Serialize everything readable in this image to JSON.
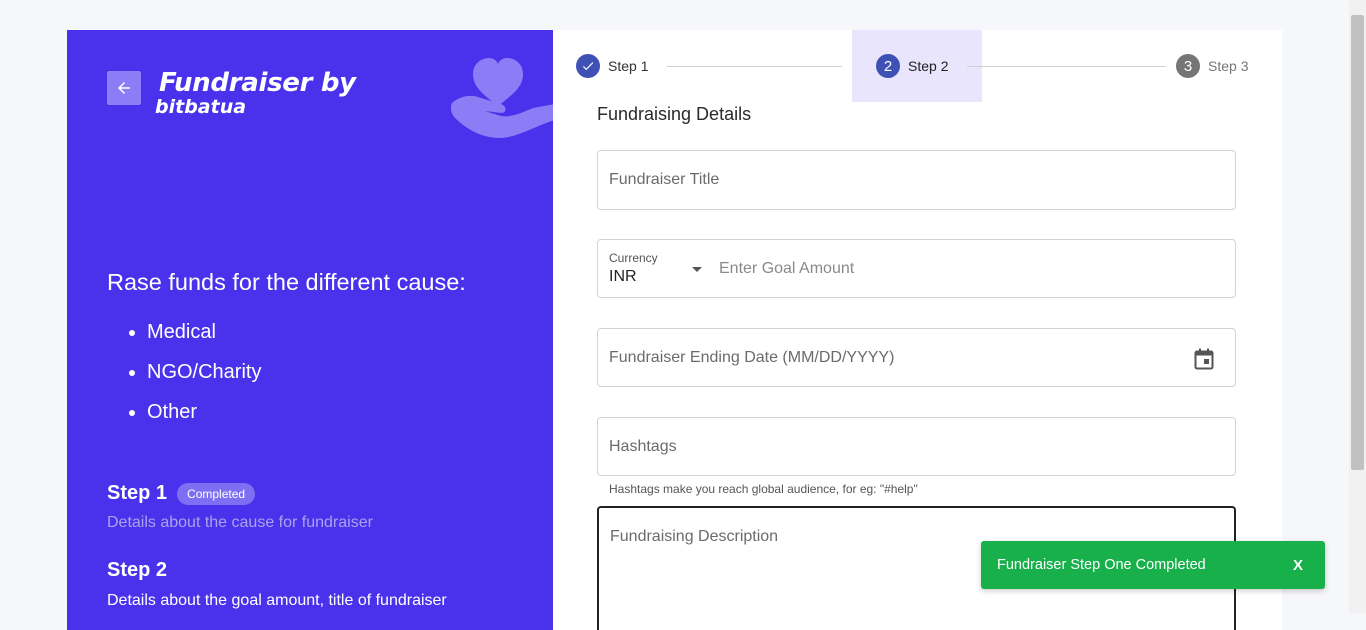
{
  "brand": {
    "line1": "Fundraiser by",
    "line2": "bitbatua"
  },
  "left": {
    "cause_title": "Rase funds for the different cause:",
    "causes": [
      "Medical",
      "NGO/Charity",
      "Other"
    ],
    "step1": {
      "title": "Step 1",
      "badge": "Completed",
      "desc": "Details about the cause for fundraiser"
    },
    "step2": {
      "title": "Step 2",
      "desc": "Details about the goal amount, title of fundraiser"
    }
  },
  "stepper": {
    "steps": [
      {
        "label": "Step 1",
        "state": "completed"
      },
      {
        "label": "Step 2",
        "number": "2",
        "state": "active"
      },
      {
        "label": "Step 3",
        "number": "3",
        "state": "pending"
      }
    ]
  },
  "form": {
    "section_title": "Fundraising Details",
    "title_placeholder": "Fundraiser Title",
    "currency_label": "Currency",
    "currency_value": "INR",
    "goal_placeholder": "Enter Goal Amount",
    "date_placeholder": "Fundraiser Ending Date (MM/DD/YYYY)",
    "hashtags_placeholder": "Hashtags",
    "hashtags_helper": "Hashtags make you reach global audience, for eg: \"#help\"",
    "description_placeholder": "Fundraising Description"
  },
  "toast": {
    "message": "Fundraiser Step One Completed",
    "close": "X"
  },
  "colors": {
    "primary": "#4a31ec",
    "accent": "#8c7cf5",
    "step_active": "#3f51b5",
    "success": "#17b04a"
  }
}
